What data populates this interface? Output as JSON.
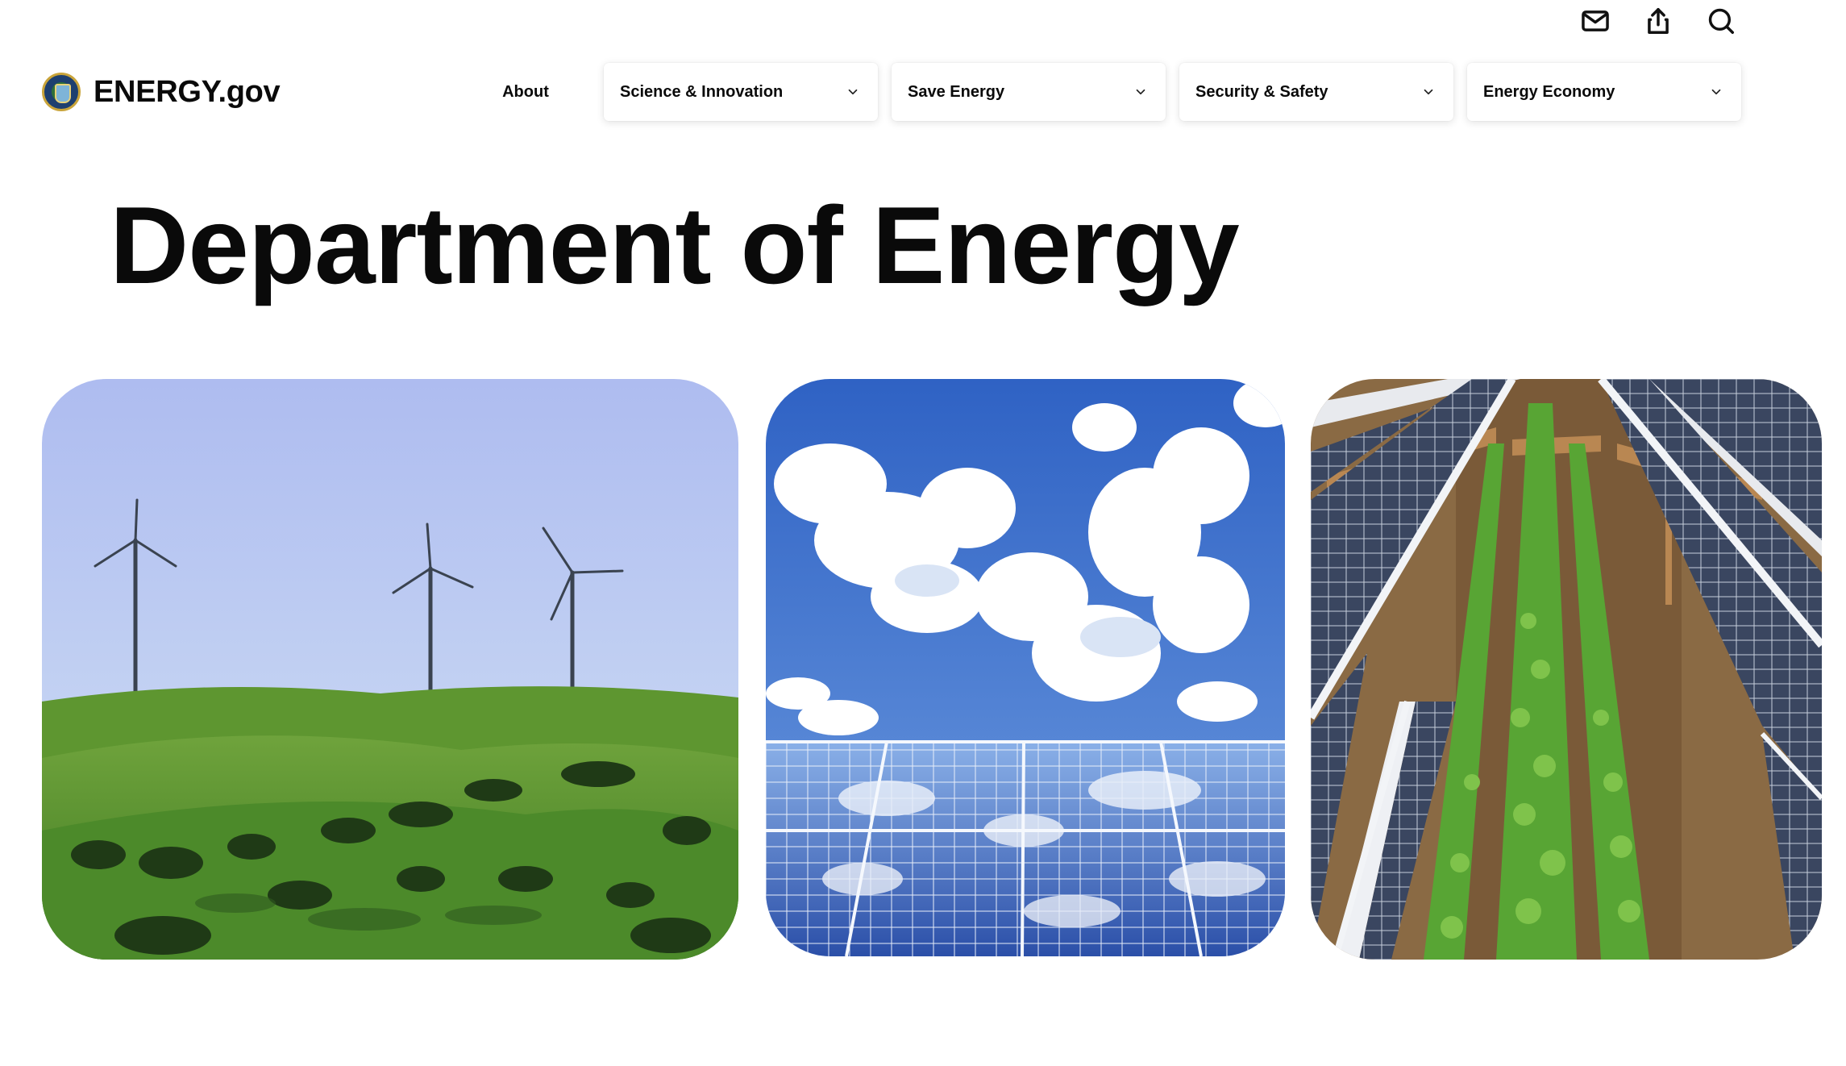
{
  "utility": {
    "icons": [
      "mail-icon",
      "share-icon",
      "search-icon"
    ]
  },
  "header": {
    "brand_name": "ENERGY.gov",
    "logo_icon": "doe-seal-icon"
  },
  "nav": {
    "about": "About",
    "dropdowns": [
      {
        "label": "Science & Innovation",
        "icon": "chevron-down-icon"
      },
      {
        "label": "Save Energy",
        "icon": "chevron-down-icon"
      },
      {
        "label": "Security & Safety",
        "icon": "chevron-down-icon"
      },
      {
        "label": "Energy Economy",
        "icon": "chevron-down-icon"
      }
    ]
  },
  "main": {
    "title": "Department of Energy",
    "images": [
      {
        "depicts": "wind-turbines-on-green-hills"
      },
      {
        "depicts": "solar-panels-reflecting-clouds"
      },
      {
        "depicts": "solar-panels-over-crops"
      }
    ]
  },
  "colors": {
    "text": "#0a0a0a",
    "background": "#ffffff",
    "sky_blue": "#4a7fd0",
    "grass_green": "#4f8a2e"
  }
}
